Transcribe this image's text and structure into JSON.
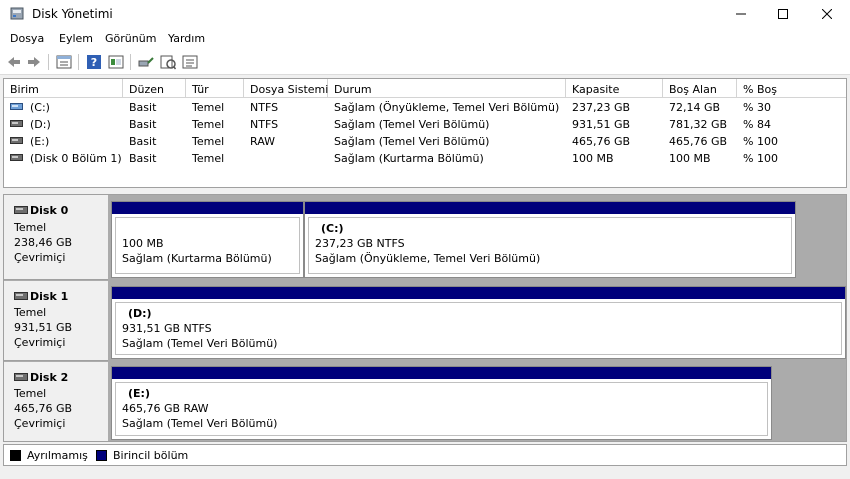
{
  "window": {
    "title": "Disk Yönetimi"
  },
  "menu": [
    "Dosya",
    "Eylem",
    "Görünüm",
    "Yardım"
  ],
  "columns": [
    "Birim",
    "Düzen",
    "Tür",
    "Dosya Sistemi",
    "Durum",
    "Kapasite",
    "Boş Alan",
    "% Boş"
  ],
  "volumes": [
    [
      "(C:)",
      "Basit",
      "Temel",
      "NTFS",
      "Sağlam (Önyükleme, Temel Veri Bölümü)",
      "237,23 GB",
      "72,14 GB",
      "% 30"
    ],
    [
      "(D:)",
      "Basit",
      "Temel",
      "NTFS",
      "Sağlam (Temel Veri Bölümü)",
      "931,51 GB",
      "781,32 GB",
      "% 84"
    ],
    [
      "(E:)",
      "Basit",
      "Temel",
      "RAW",
      "Sağlam (Temel Veri Bölümü)",
      "465,76 GB",
      "465,76 GB",
      "% 100"
    ],
    [
      "(Disk 0 Bölüm 1)",
      "Basit",
      "Temel",
      "",
      "Sağlam (Kurtarma Bölümü)",
      "100 MB",
      "100 MB",
      "% 100"
    ]
  ],
  "disks": [
    {
      "name": "Disk 0",
      "type": "Temel",
      "size": "238,46 GB",
      "status": "Çevrimiçi",
      "partitions": [
        {
          "label": "",
          "size": "100 MB",
          "status": "Sağlam (Kurtarma Bölümü)"
        },
        {
          "label": "(C:)",
          "size": "237,23 GB NTFS",
          "status": "Sağlam (Önyükleme, Temel Veri Bölümü)"
        }
      ]
    },
    {
      "name": "Disk 1",
      "type": "Temel",
      "size": "931,51 GB",
      "status": "Çevrimiçi",
      "partitions": [
        {
          "label": "(D:)",
          "size": "931,51 GB NTFS",
          "status": "Sağlam (Temel Veri Bölümü)"
        }
      ]
    },
    {
      "name": "Disk 2",
      "type": "Temel",
      "size": "465,76 GB",
      "status": "Çevrimiçi",
      "partitions": [
        {
          "label": "(E:)",
          "size": "465,76 GB RAW",
          "status": "Sağlam (Temel Veri Bölümü)"
        }
      ]
    }
  ],
  "legend": [
    {
      "label": "Ayrılmamış",
      "color": "#000000"
    },
    {
      "label": "Birincil bölüm",
      "color": "#00007b"
    }
  ],
  "icons": [
    "disk-management-icon",
    "minimize-icon",
    "maximize-icon",
    "close-icon",
    "back-icon",
    "forward-icon",
    "properties-icon",
    "help-icon",
    "console-icon",
    "connect-icon",
    "check-icon",
    "list-icon"
  ]
}
